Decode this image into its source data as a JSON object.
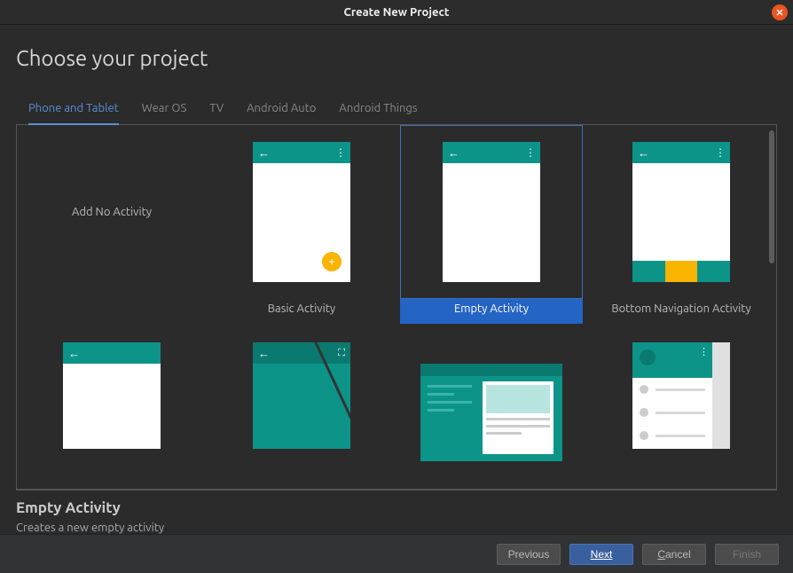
{
  "window": {
    "title": "Create New Project"
  },
  "header": {
    "title": "Choose your project"
  },
  "tabs": [
    {
      "label": "Phone and Tablet",
      "active": true
    },
    {
      "label": "Wear OS",
      "active": false
    },
    {
      "label": "TV",
      "active": false
    },
    {
      "label": "Android Auto",
      "active": false
    },
    {
      "label": "Android Things",
      "active": false
    }
  ],
  "templates": {
    "row1": [
      {
        "label": "Add No Activity",
        "kind": "none"
      },
      {
        "label": "Basic Activity",
        "kind": "basic"
      },
      {
        "label": "Empty Activity",
        "kind": "empty",
        "selected": true
      },
      {
        "label": "Bottom Navigation Activity",
        "kind": "bottomnav"
      }
    ],
    "row2": [
      {
        "kind": "simple"
      },
      {
        "kind": "fullscreen"
      },
      {
        "kind": "masterdetail"
      },
      {
        "kind": "navdrawer"
      }
    ]
  },
  "description": {
    "title": "Empty Activity",
    "text": "Creates a new empty activity"
  },
  "buttons": {
    "previous": "Previous",
    "next": "Next",
    "cancel": "Cancel",
    "finish": "Finish"
  },
  "colors": {
    "accent": "#0d9488",
    "selection": "#2464c4",
    "fab": "#f9b400",
    "close": "#e95420"
  }
}
